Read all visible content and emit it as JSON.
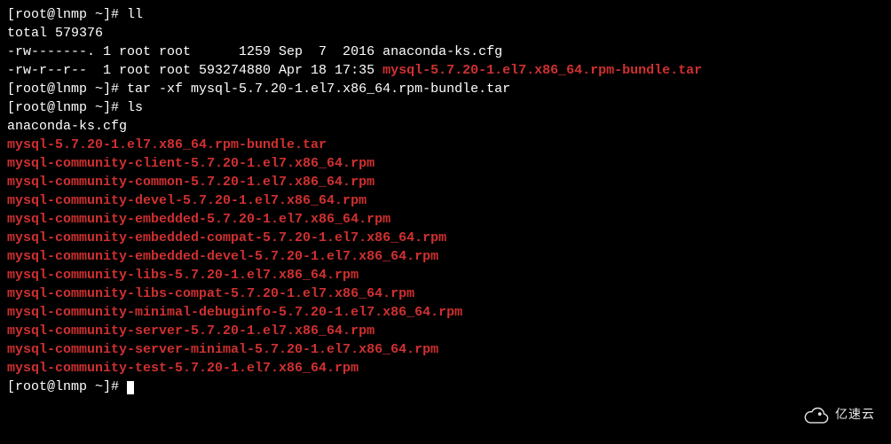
{
  "prompts": {
    "p1": "[root@lnmp ~]# ",
    "p2": "[root@lnmp ~]# ",
    "p3": "[root@lnmp ~]# ",
    "p4": "[root@lnmp ~]#"
  },
  "commands": {
    "c1": "ll",
    "c2": "tar -xf mysql-5.7.20-1.el7.x86_64.rpm-bundle.tar",
    "c3": "ls"
  },
  "output": {
    "total": "total 579376",
    "row1_left": "-rw-------. 1 root root      1259 Sep  7  2016 anaconda-ks.cfg",
    "row2_left": "-rw-r--r--  1 root root 593274880 Apr 18 17:35 ",
    "row2_file": "mysql-5.7.20-1.el7.x86_64.rpm-bundle.tar",
    "ls_plain": "anaconda-ks.cfg",
    "ls_files": [
      "mysql-5.7.20-1.el7.x86_64.rpm-bundle.tar",
      "mysql-community-client-5.7.20-1.el7.x86_64.rpm",
      "mysql-community-common-5.7.20-1.el7.x86_64.rpm",
      "mysql-community-devel-5.7.20-1.el7.x86_64.rpm",
      "mysql-community-embedded-5.7.20-1.el7.x86_64.rpm",
      "mysql-community-embedded-compat-5.7.20-1.el7.x86_64.rpm",
      "mysql-community-embedded-devel-5.7.20-1.el7.x86_64.rpm",
      "mysql-community-libs-5.7.20-1.el7.x86_64.rpm",
      "mysql-community-libs-compat-5.7.20-1.el7.x86_64.rpm",
      "mysql-community-minimal-debuginfo-5.7.20-1.el7.x86_64.rpm",
      "mysql-community-server-5.7.20-1.el7.x86_64.rpm",
      "mysql-community-server-minimal-5.7.20-1.el7.x86_64.rpm",
      "mysql-community-test-5.7.20-1.el7.x86_64.rpm"
    ]
  },
  "watermark": {
    "text": "亿速云"
  }
}
